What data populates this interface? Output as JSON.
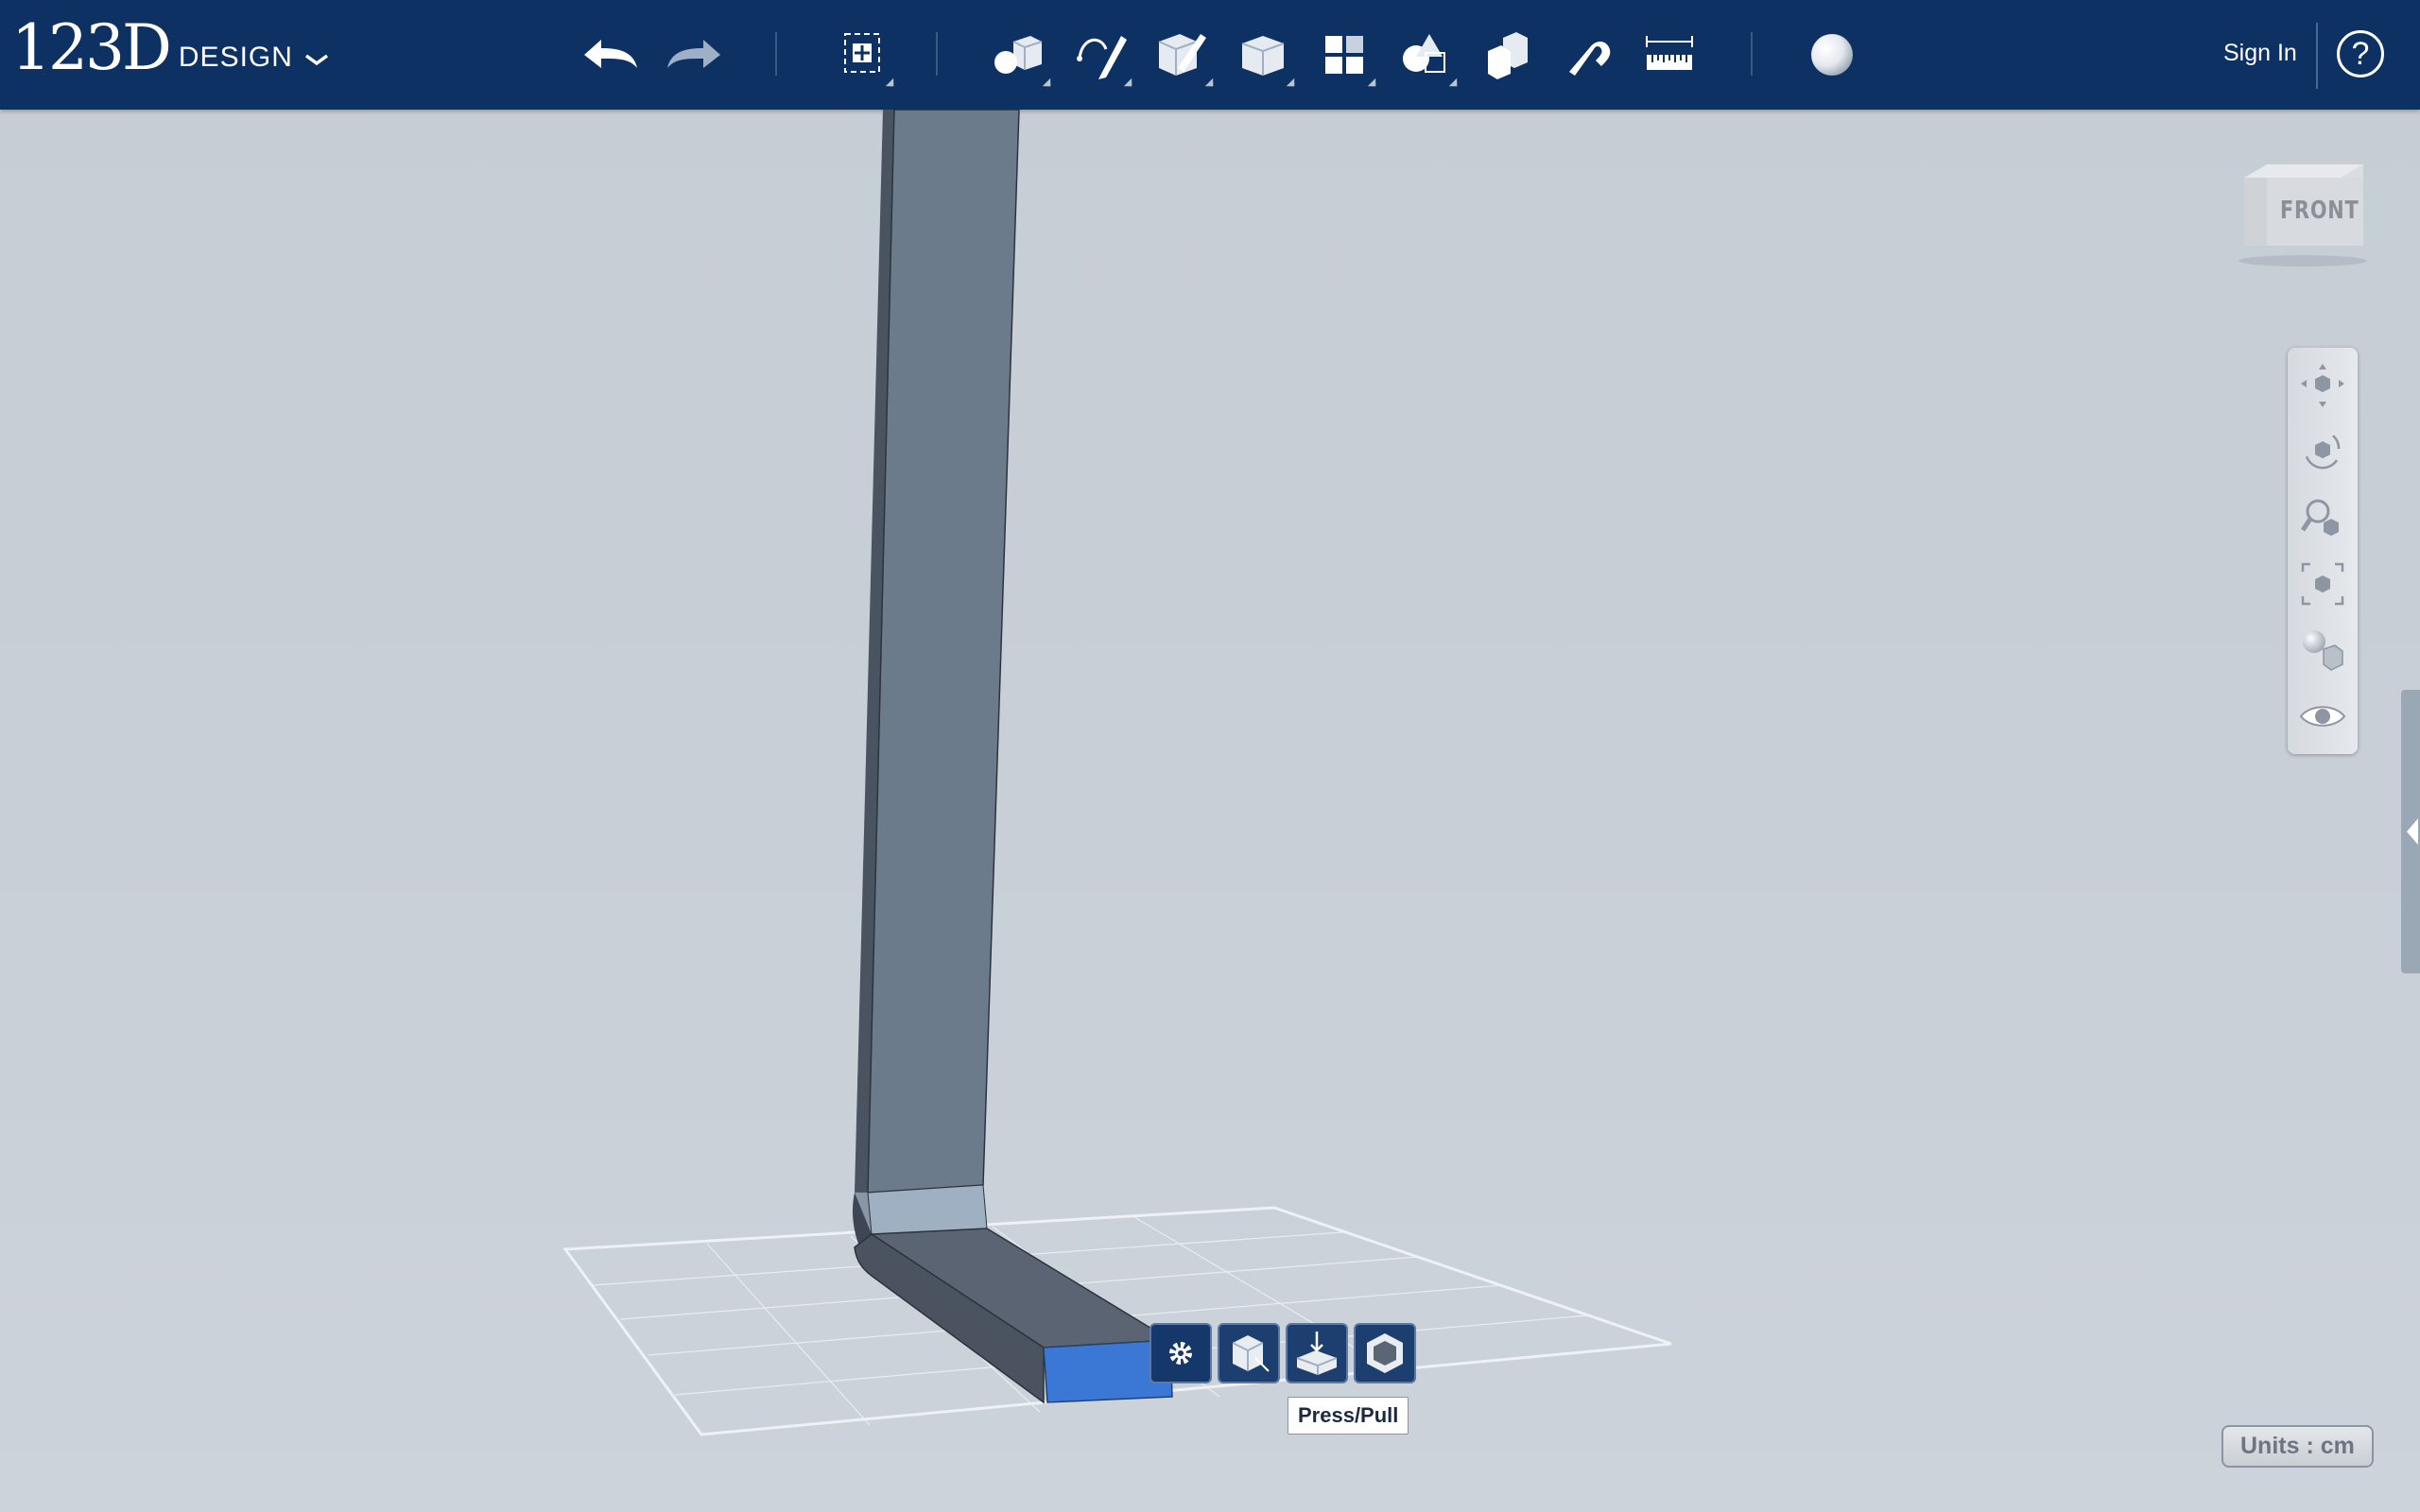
{
  "app": {
    "logo_main": "123D",
    "logo_sub": "DESIGN"
  },
  "toolbar": {
    "tools": [
      {
        "name": "undo-icon"
      },
      {
        "name": "redo-icon"
      },
      {
        "name": "transform-icon"
      },
      {
        "name": "primitives-icon"
      },
      {
        "name": "sketch-icon"
      },
      {
        "name": "construct-icon"
      },
      {
        "name": "modify-icon"
      },
      {
        "name": "pattern-icon"
      },
      {
        "name": "grouping-icon"
      },
      {
        "name": "combine-icon"
      },
      {
        "name": "snap-icon"
      },
      {
        "name": "measure-icon"
      },
      {
        "name": "material-icon"
      }
    ],
    "sign_in": "Sign In",
    "help": "?"
  },
  "viewcube": {
    "label": "FRONT"
  },
  "navbar": {
    "items": [
      "pan-icon",
      "orbit-icon",
      "zoom-icon",
      "fit-icon",
      "view-mode-icon",
      "visibility-icon"
    ]
  },
  "context_toolbar": {
    "items": [
      "settings-icon",
      "tweak-icon",
      "press-pull-icon",
      "shell-icon"
    ],
    "tooltip": "Press/Pull"
  },
  "status": {
    "units": "Units : cm"
  },
  "colors": {
    "topbar": "#0d3163",
    "viewport_bg": "#c8cfd7",
    "model_face": "#6b7a8a",
    "selected_face": "#3b78d6"
  }
}
